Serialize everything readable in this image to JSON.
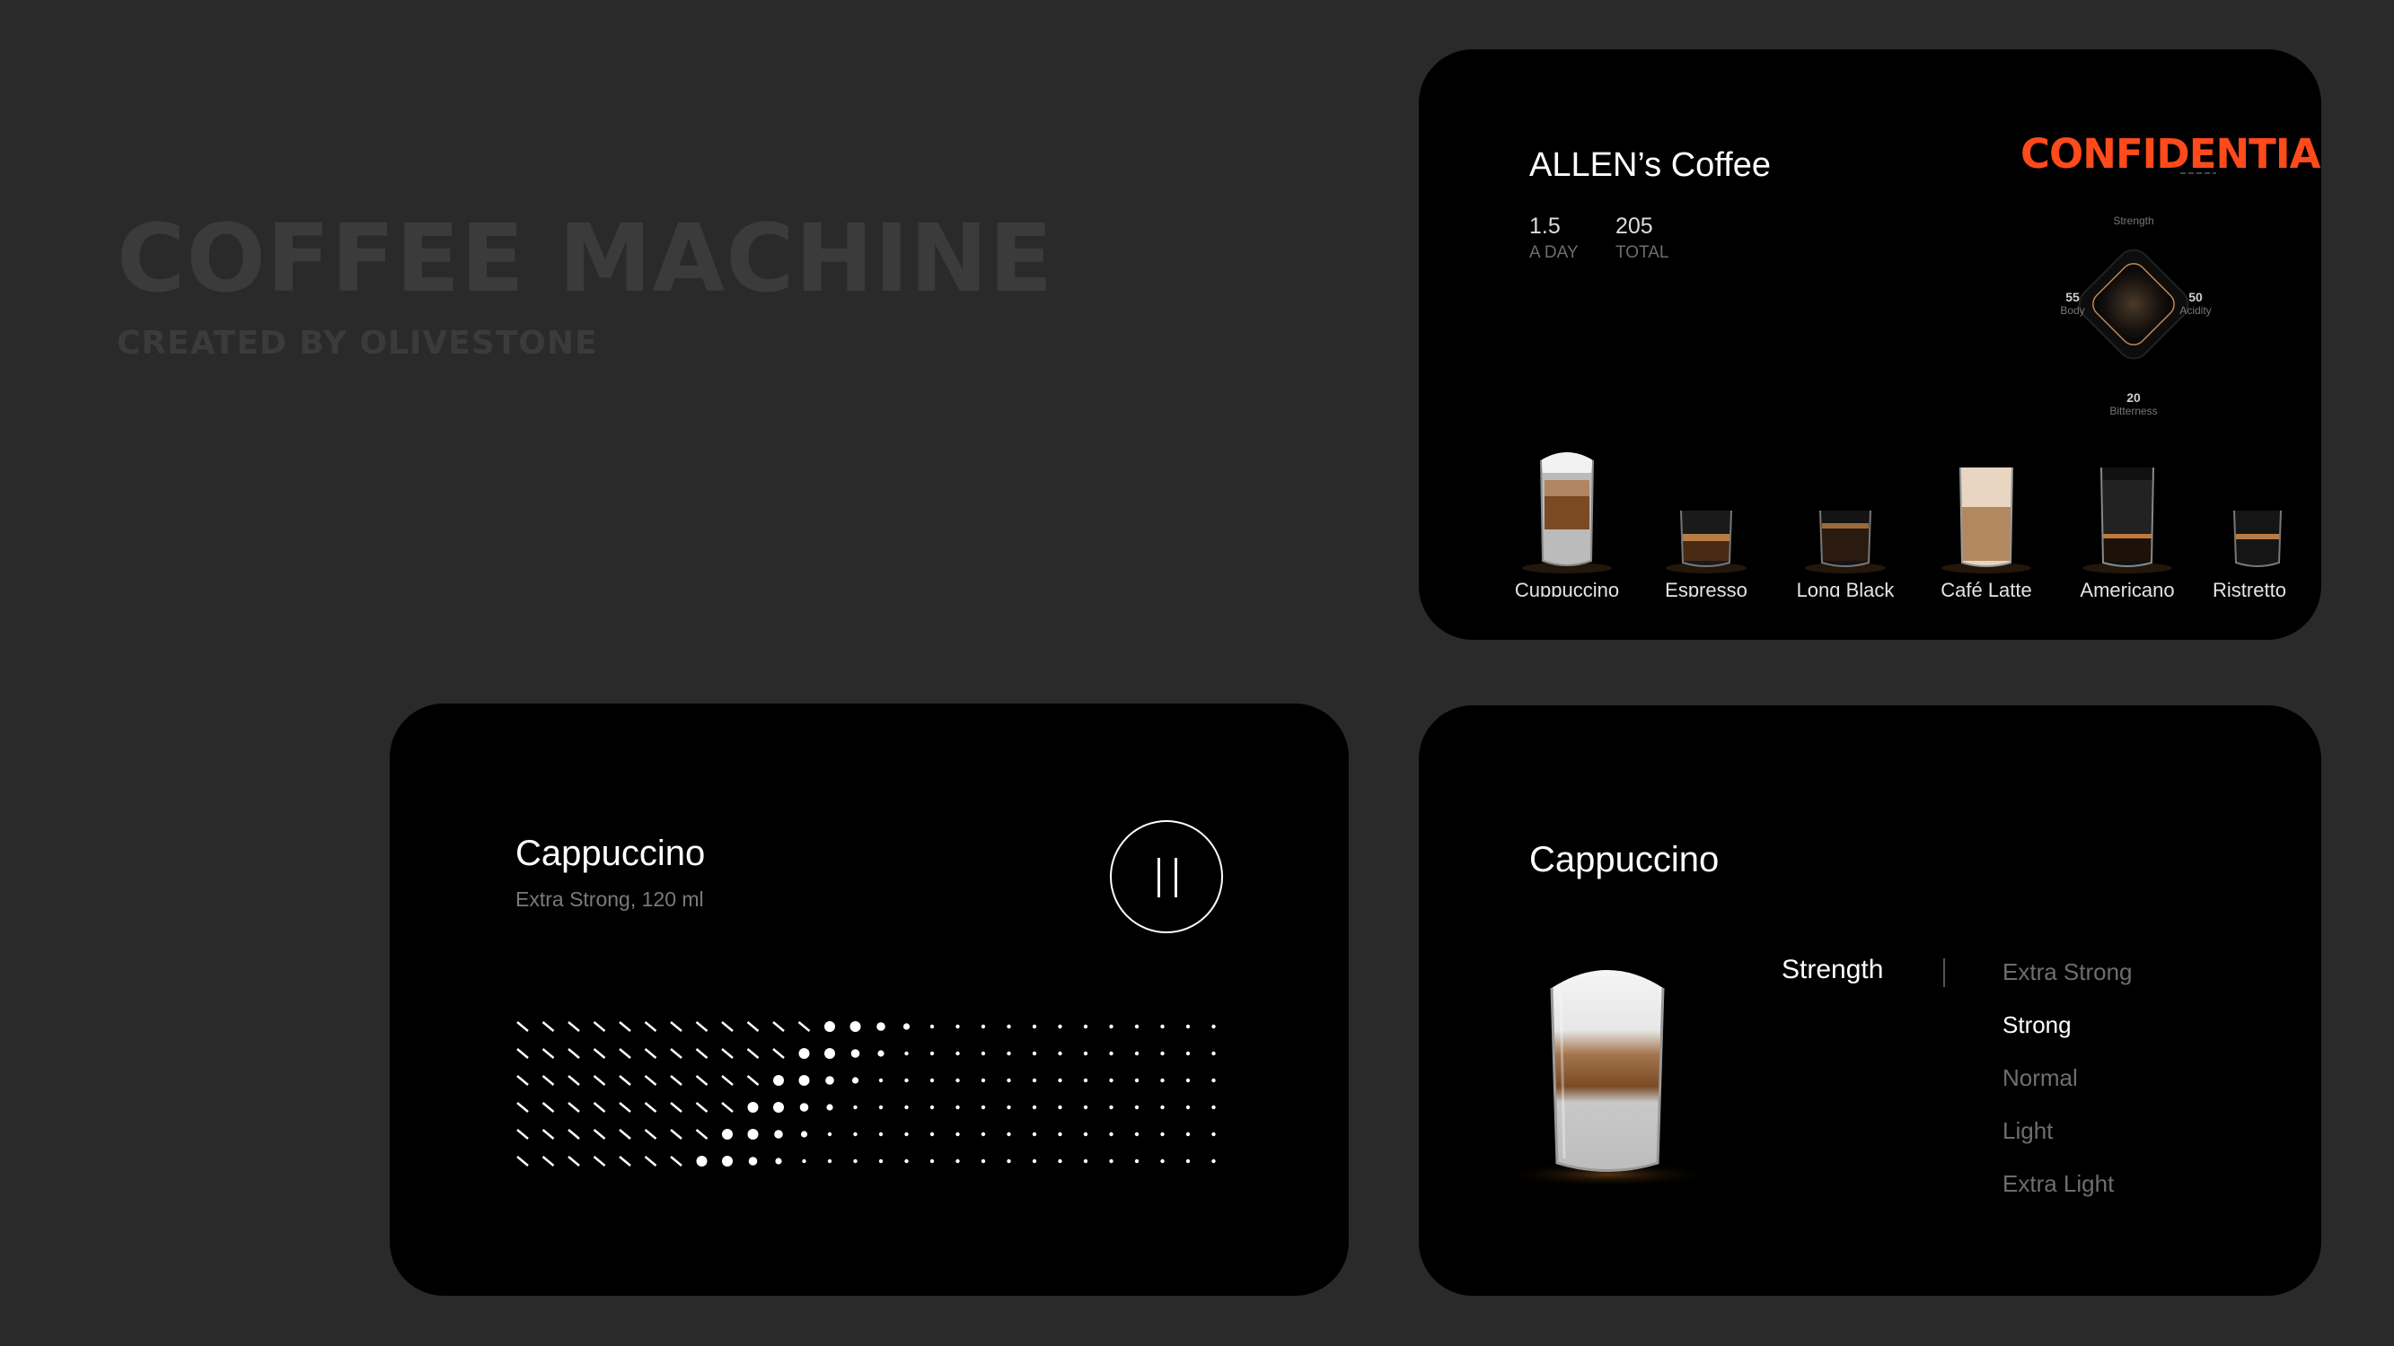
{
  "brand": {
    "title": "COFFEE MACHINE",
    "subtitle": "CREATED BY OLIVESTONE"
  },
  "profile": {
    "title": "ALLEN’s Coffee",
    "stats": [
      {
        "value": "1.5",
        "label": "A DAY"
      },
      {
        "value": "205",
        "label": "TOTAL"
      }
    ],
    "watermark": "CONFIDENTIAL",
    "taste": {
      "strength": {
        "label": "Strength"
      },
      "body": {
        "value": "55",
        "label": "Body"
      },
      "acidity": {
        "value": "50",
        "label": "Acidity"
      },
      "bitterness": {
        "value": "20",
        "label": "Bitterness"
      }
    },
    "drinks": [
      {
        "label": "Cuppuccino",
        "icon": "cappuccino-glass-icon"
      },
      {
        "label": "Espresso",
        "icon": "espresso-glass-icon"
      },
      {
        "label": "Long Black",
        "icon": "long-black-glass-icon"
      },
      {
        "label": "Café Latte",
        "icon": "latte-glass-icon"
      },
      {
        "label": "Americano",
        "icon": "americano-glass-icon"
      },
      {
        "label": "Ristretto",
        "icon": "ristretto-glass-icon"
      }
    ]
  },
  "brewing": {
    "title": "Cappuccino",
    "subtitle": "Extra Strong, 120 ml",
    "pause_icon": "pause-icon"
  },
  "strength": {
    "title": "Cappuccino",
    "label": "Strength",
    "options": [
      "Extra Strong",
      "Strong",
      "Normal",
      "Light",
      "Extra Light"
    ],
    "selected": "Strong"
  },
  "colors": {
    "background": "#2a2a2a",
    "card": "#000000",
    "accent": "#ff4a1c",
    "coffee": "#7a4a24"
  }
}
